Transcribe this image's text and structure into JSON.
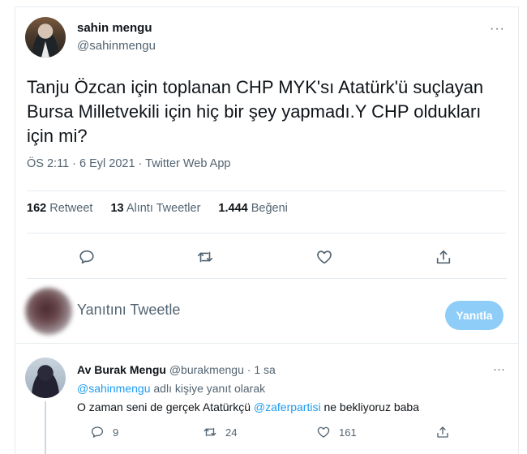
{
  "tweet": {
    "author_name": "sahin mengu",
    "author_handle": "@sahinmengu",
    "more": "···",
    "text": "Tanju Özcan için toplanan CHP MYK'sı Atatürk'ü suçlayan Bursa Milletvekili için hiç bir şey yapmadı.Y CHP oldukları için mi?",
    "meta": "ÖS 2:11 · 6 Eyl 2021 · Twitter Web App",
    "stats": {
      "retweets_count": "162",
      "retweets_label": "Retweet",
      "quotes_count": "13",
      "quotes_label": "Alıntı Tweetler",
      "likes_count": "1.444",
      "likes_label": "Beğeni"
    },
    "actions": [
      "reply-icon",
      "retweet-icon",
      "like-icon",
      "share-icon"
    ]
  },
  "compose": {
    "placeholder": "Yanıtını Tweetle",
    "button_label": "Yanıtla",
    "button_color": "#8ecdf8"
  },
  "reply": {
    "author_name": "Av Burak Mengu",
    "author_handle": "@burakmengu",
    "time": "· 1 sa",
    "more": "···",
    "replying_to_mention": "@sahinmengu",
    "replying_to_text": " adlı kişiye yanıt olarak",
    "text_before": "O zaman seni de gerçek Atatürkçü ",
    "text_mention": "@zaferpartisi",
    "text_after": " ne bekliyoruz baba",
    "reply_count": "9",
    "retweet_count": "24",
    "like_count": "161"
  },
  "colors": {
    "link": "#1d9bf0",
    "secondary_text": "#536471",
    "primary_text": "#0f1419"
  }
}
